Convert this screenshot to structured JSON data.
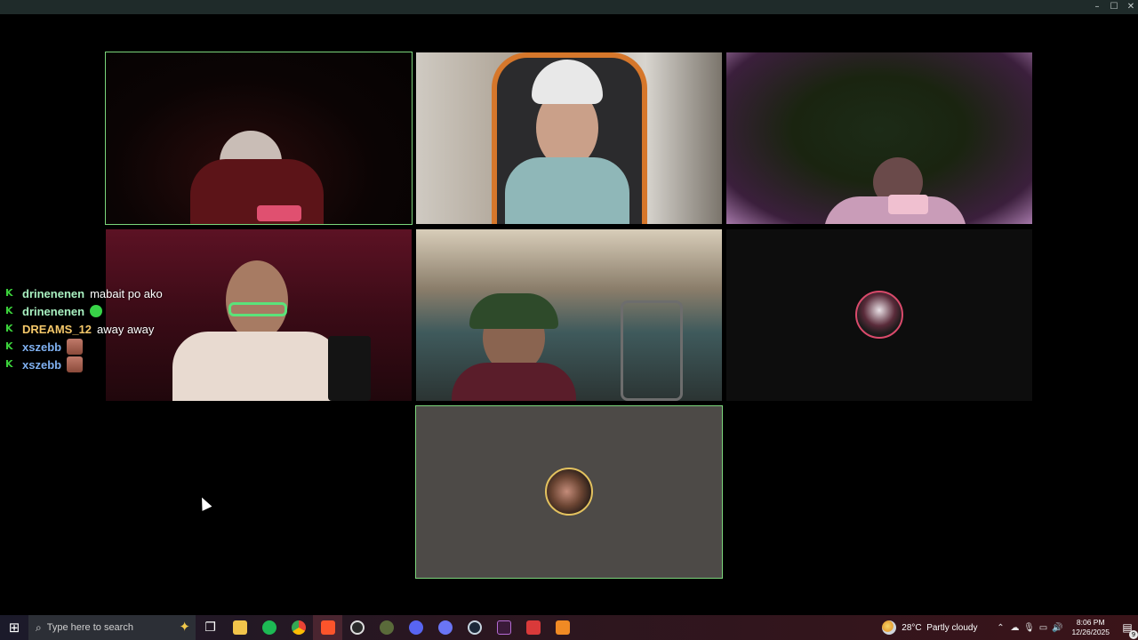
{
  "window": {
    "minimize_icon": "minimize-icon",
    "maximize_icon": "maximize-icon",
    "close_icon": "close-icon"
  },
  "tiles": [
    {
      "kind": "video",
      "speaking": true
    },
    {
      "kind": "video",
      "speaking": false
    },
    {
      "kind": "video",
      "speaking": false
    },
    {
      "kind": "video",
      "speaking": false
    },
    {
      "kind": "video",
      "speaking": false
    },
    {
      "kind": "avatar",
      "speaking": false
    },
    {
      "kind": "avatar",
      "speaking": true
    }
  ],
  "chat": [
    {
      "user": "drinenenen",
      "color": "#a8f0c0",
      "message": "mabait po ako",
      "emote": null
    },
    {
      "user": "drinenenen",
      "color": "#a8f0c0",
      "message": "",
      "emote": "green-emote"
    },
    {
      "user": "DREAMS_12",
      "color": "#f5c86a",
      "message": "away away",
      "emote": null
    },
    {
      "user": "xszebb",
      "color": "#7fb0f0",
      "message": "",
      "emote": "face-emote"
    },
    {
      "user": "xszebb",
      "color": "#7fb0f0",
      "message": "",
      "emote": "face-emote"
    }
  ],
  "taskbar": {
    "search_placeholder": "Type here to search",
    "apps": [
      "task-view-icon",
      "file-explorer-icon",
      "spotify-icon",
      "chrome-icon",
      "brave-icon",
      "obs-icon",
      "app-icon",
      "discord-ptb-icon",
      "discord-icon",
      "steam-icon",
      "editor-icon",
      "vpn-icon",
      "pdf-icon"
    ],
    "weather_temp": "28°C",
    "weather_desc": "Partly cloudy",
    "time": "8:06 PM",
    "date": "12/26/2025",
    "notification_count": "9"
  },
  "colors": {
    "speaking_outline": "#7bd67b",
    "taskbar": "#2a1620"
  }
}
